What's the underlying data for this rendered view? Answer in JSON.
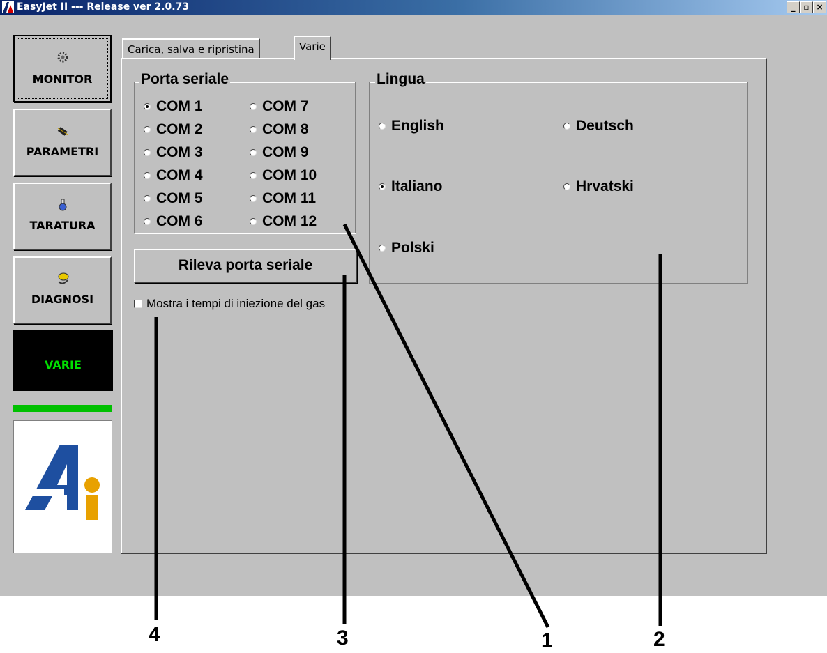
{
  "window": {
    "title": "EasyJet II --- Release ver 2.0.73",
    "controls": {
      "minimize": "_",
      "maximize": "▫",
      "close": "×"
    }
  },
  "sidebar": {
    "items": [
      {
        "label": "MONITOR",
        "icon": "gear-icon"
      },
      {
        "label": "PARAMETRI",
        "icon": "chip-icon"
      },
      {
        "label": "TARATURA",
        "icon": "flask-icon"
      },
      {
        "label": "DIAGNOSI",
        "icon": "mechanic-icon"
      },
      {
        "label": "VARIE",
        "icon": ""
      }
    ],
    "logo": {
      "letter": "A",
      "sub": "i"
    }
  },
  "tabs": [
    {
      "label": "Carica, salva e ripristina"
    },
    {
      "label": "Varie"
    }
  ],
  "serial": {
    "legend": "Porta seriale",
    "ports": [
      "COM 1",
      "COM 2",
      "COM 3",
      "COM 4",
      "COM 5",
      "COM 6",
      "COM 7",
      "COM 8",
      "COM 9",
      "COM 10",
      "COM 11",
      "COM 12"
    ],
    "selected": "COM 1",
    "detect_button": "Rileva porta seriale"
  },
  "language": {
    "legend": "Lingua",
    "options": [
      "English",
      "Deutsch",
      "Italiano",
      "Hrvatski",
      "Polski"
    ],
    "selected": "Italiano"
  },
  "gas_times": {
    "label": "Mostra i tempi di iniezione del gas",
    "checked": false
  },
  "callouts": [
    "4",
    "3",
    "1",
    "2"
  ],
  "colors": {
    "titlebar_start": "#0a246a",
    "face": "#c0c0c0",
    "active_text": "#00e000",
    "status_bar": "#00c000"
  }
}
